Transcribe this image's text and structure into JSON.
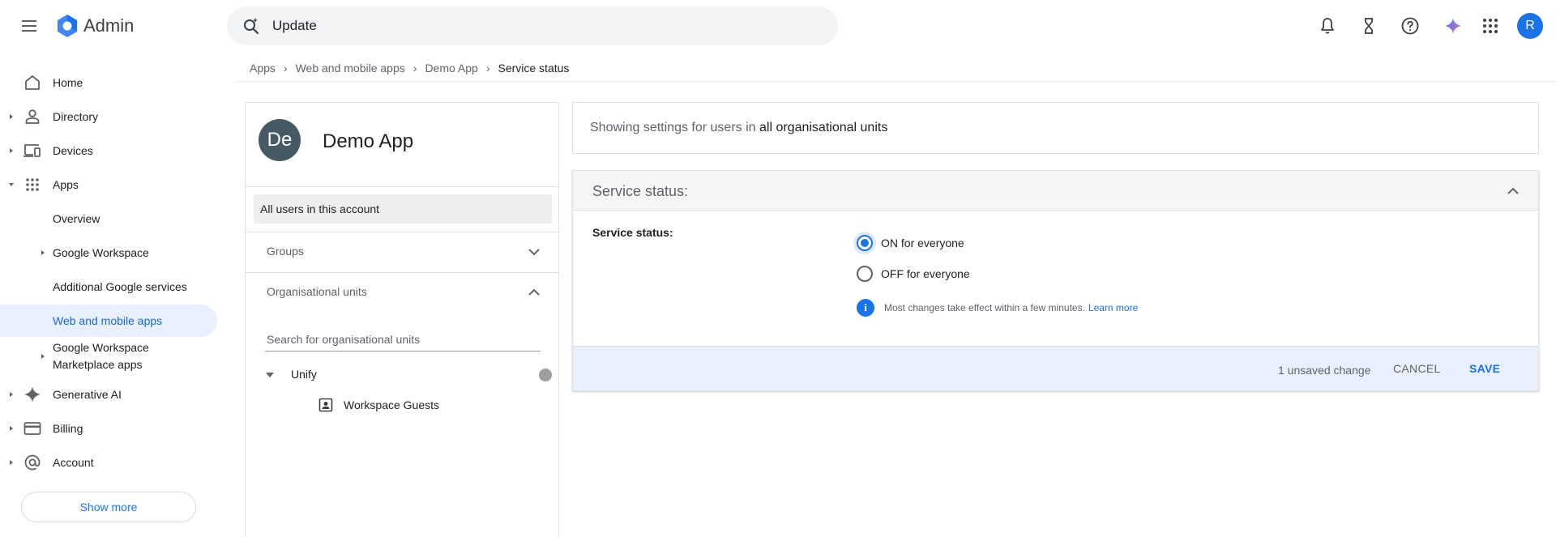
{
  "header": {
    "app_name": "Admin",
    "search_value": "Update",
    "avatar_initial": "R"
  },
  "breadcrumb": [
    "Apps",
    "Web and mobile apps",
    "Demo App",
    "Service status"
  ],
  "sidebar": {
    "items": [
      {
        "label": "Home",
        "icon": "home-icon"
      },
      {
        "label": "Directory",
        "icon": "person-icon"
      },
      {
        "label": "Devices",
        "icon": "devices-icon"
      },
      {
        "label": "Apps",
        "icon": "apps-grid-icon"
      },
      {
        "label": "Overview"
      },
      {
        "label": "Google Workspace"
      },
      {
        "label": "Additional Google services"
      },
      {
        "label": "Web and mobile apps",
        "active": true
      },
      {
        "label": "Google Workspace",
        "label2": "Marketplace apps"
      },
      {
        "label": "Generative AI",
        "icon": "sparkle-icon"
      },
      {
        "label": "Billing",
        "icon": "credit-card-icon"
      },
      {
        "label": "Account",
        "icon": "at-sign-icon"
      }
    ],
    "show_more": "Show more"
  },
  "org_panel": {
    "avatar_initials": "De",
    "app_title": "Demo App",
    "all_users": "All users in this account",
    "groups_label": "Groups",
    "org_units_label": "Organisational units",
    "search_placeholder": "Search for organisational units",
    "tree": [
      {
        "label": "Unify"
      },
      {
        "label": "Workspace Guests"
      }
    ]
  },
  "settings": {
    "scope_prefix": "Showing settings for users in ",
    "scope_value": "all organisational units",
    "card_title": "Service status:",
    "field_label": "Service status:",
    "options": [
      {
        "label": "ON for everyone",
        "checked": true
      },
      {
        "label": "OFF for everyone",
        "checked": false
      }
    ],
    "info_text": "Most changes take effect within a few minutes.",
    "learn_more": "Learn more",
    "unsaved": "1 unsaved change",
    "cancel": "CANCEL",
    "save": "SAVE"
  },
  "colors": {
    "accent": "#1a73e8",
    "active_nav_bg": "#e8f0fe",
    "footer_bg": "#e8f0fe"
  }
}
